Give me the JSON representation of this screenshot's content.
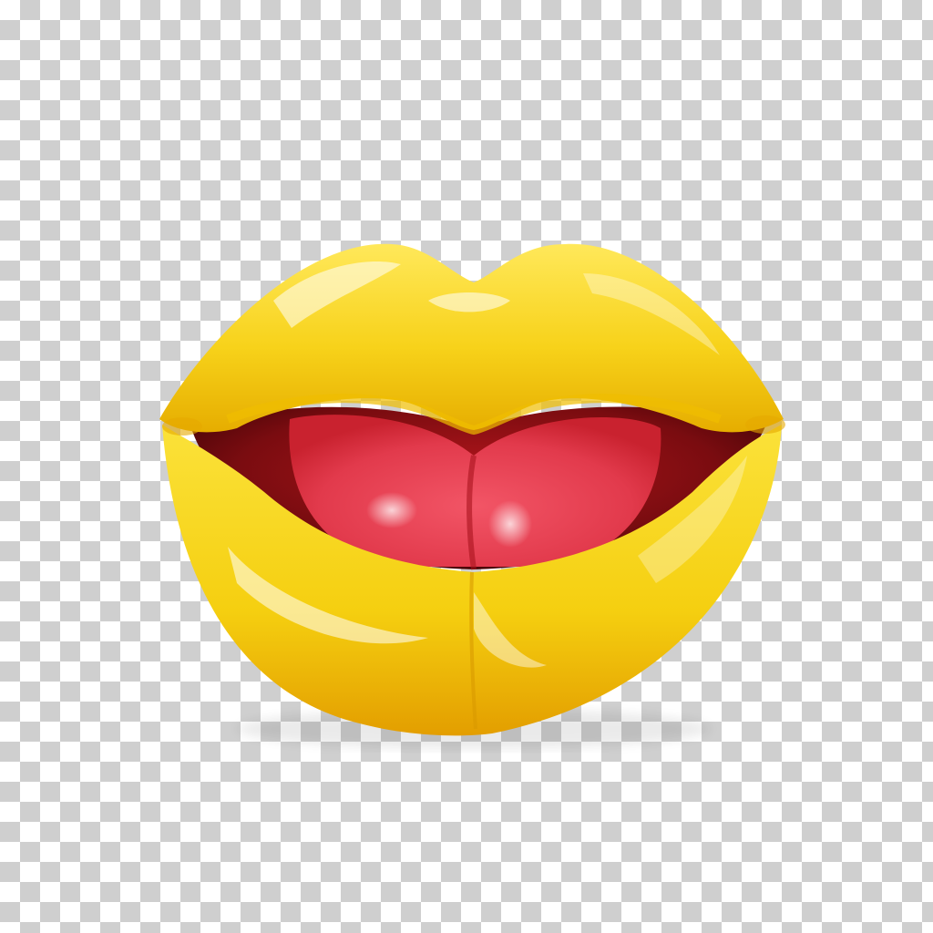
{
  "image": {
    "subject": "",
    "background_pattern": "transparency-checkerboard",
    "colors": {
      "checker_light": "#ffffff",
      "checker_dark": "#cfcfcf",
      "lip_base": "#f7d21a",
      "lip_highlight": "#fff3a0",
      "lip_shadow": "#e0a800",
      "mouth_interior": "#7a0c10",
      "tongue": "#e8485a",
      "tongue_highlight": "#ff9aa6"
    },
    "icons": [
      "lips-icon",
      "tongue-icon"
    ]
  }
}
